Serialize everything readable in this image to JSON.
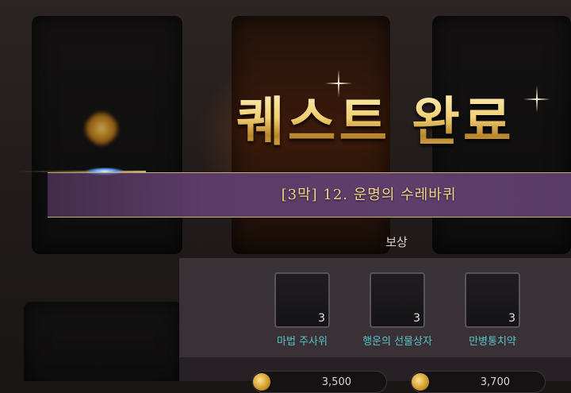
{
  "title": "퀘스트 완료",
  "quest_name": "[3막] 12. 운명의 수레바퀴",
  "reward_label": "보상",
  "rewards": [
    {
      "name": "마법 주사위",
      "count": "3"
    },
    {
      "name": "행운의 선물상자",
      "count": "3"
    },
    {
      "name": "만병통치약",
      "count": "3"
    }
  ],
  "currency": [
    {
      "icon": "gold-coin-icon",
      "value": "3,500"
    },
    {
      "icon": "gold-coin-icon",
      "value": "3,700"
    }
  ],
  "colors": {
    "title_gold": "#f1cf72",
    "banner_purple": "#5c3b67",
    "item_name_teal": "#57c3c9"
  }
}
